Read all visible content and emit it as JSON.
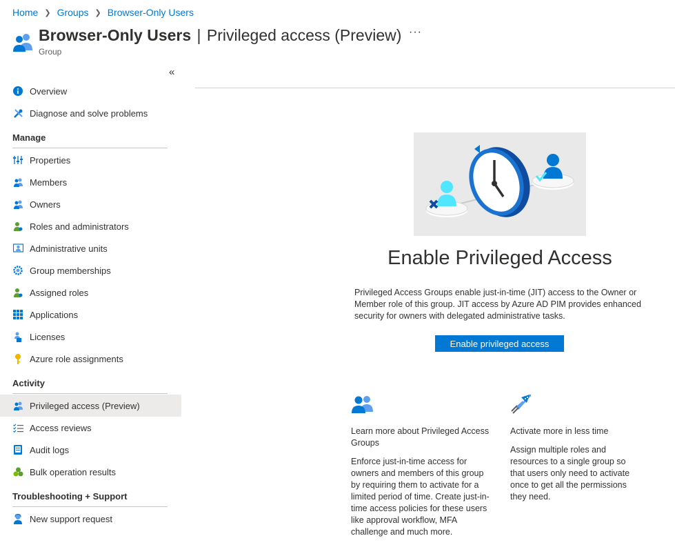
{
  "breadcrumb": {
    "home": "Home",
    "groups": "Groups",
    "group": "Browser-Only Users"
  },
  "header": {
    "title_bold": "Browser-Only Users",
    "separator": "|",
    "title_page": "Privileged access (Preview)",
    "subtitle": "Group",
    "more_label": "···"
  },
  "sidebar": {
    "collapse_label": "«",
    "top_items": [
      {
        "label": "Overview",
        "icon": "info-icon"
      },
      {
        "label": "Diagnose and solve problems",
        "icon": "wrench-icon"
      }
    ],
    "sections": {
      "manage": "Manage",
      "activity": "Activity",
      "support": "Troubleshooting + Support"
    },
    "manage_items": [
      {
        "label": "Properties",
        "icon": "properties-icon"
      },
      {
        "label": "Members",
        "icon": "members-icon"
      },
      {
        "label": "Owners",
        "icon": "owners-icon"
      },
      {
        "label": "Roles and administrators",
        "icon": "roles-icon"
      },
      {
        "label": "Administrative units",
        "icon": "admin-units-icon"
      },
      {
        "label": "Group memberships",
        "icon": "gear-icon"
      },
      {
        "label": "Assigned roles",
        "icon": "assigned-roles-icon"
      },
      {
        "label": "Applications",
        "icon": "apps-grid-icon"
      },
      {
        "label": "Licenses",
        "icon": "licenses-icon"
      },
      {
        "label": "Azure role assignments",
        "icon": "key-icon"
      }
    ],
    "activity_items": [
      {
        "label": "Privileged access (Preview)",
        "icon": "privileged-access-icon",
        "active": true
      },
      {
        "label": "Access reviews",
        "icon": "checklist-icon"
      },
      {
        "label": "Audit logs",
        "icon": "audit-log-icon"
      },
      {
        "label": "Bulk operation results",
        "icon": "bulk-ops-icon"
      }
    ],
    "support_items": [
      {
        "label": "New support request",
        "icon": "support-icon"
      }
    ]
  },
  "main": {
    "title": "Enable Privileged Access",
    "description": "Privileged Access Groups enable just-in-time (JIT) access to the Owner or Member role of this group. JIT access by Azure AD PIM provides enhanced security for owners with delegated administrative tasks.",
    "button_label": "Enable privileged access",
    "cards": [
      {
        "title": "Learn more about Privileged Access Groups",
        "body": "Enforce just-in-time access for owners and members of this group by requiring them to activate for a limited period of time. Create just-in-time access policies for these users like approval workflow, MFA challenge and much more.",
        "icon": "group-users-icon"
      },
      {
        "title": "Activate more in less time",
        "body": "Assign multiple roles and resources to a single group so that users only need to activate once to get all the permissions they need.",
        "icon": "rocket-icon"
      }
    ]
  },
  "colors": {
    "accent": "#0078d4",
    "active_bg": "#edebe9"
  }
}
